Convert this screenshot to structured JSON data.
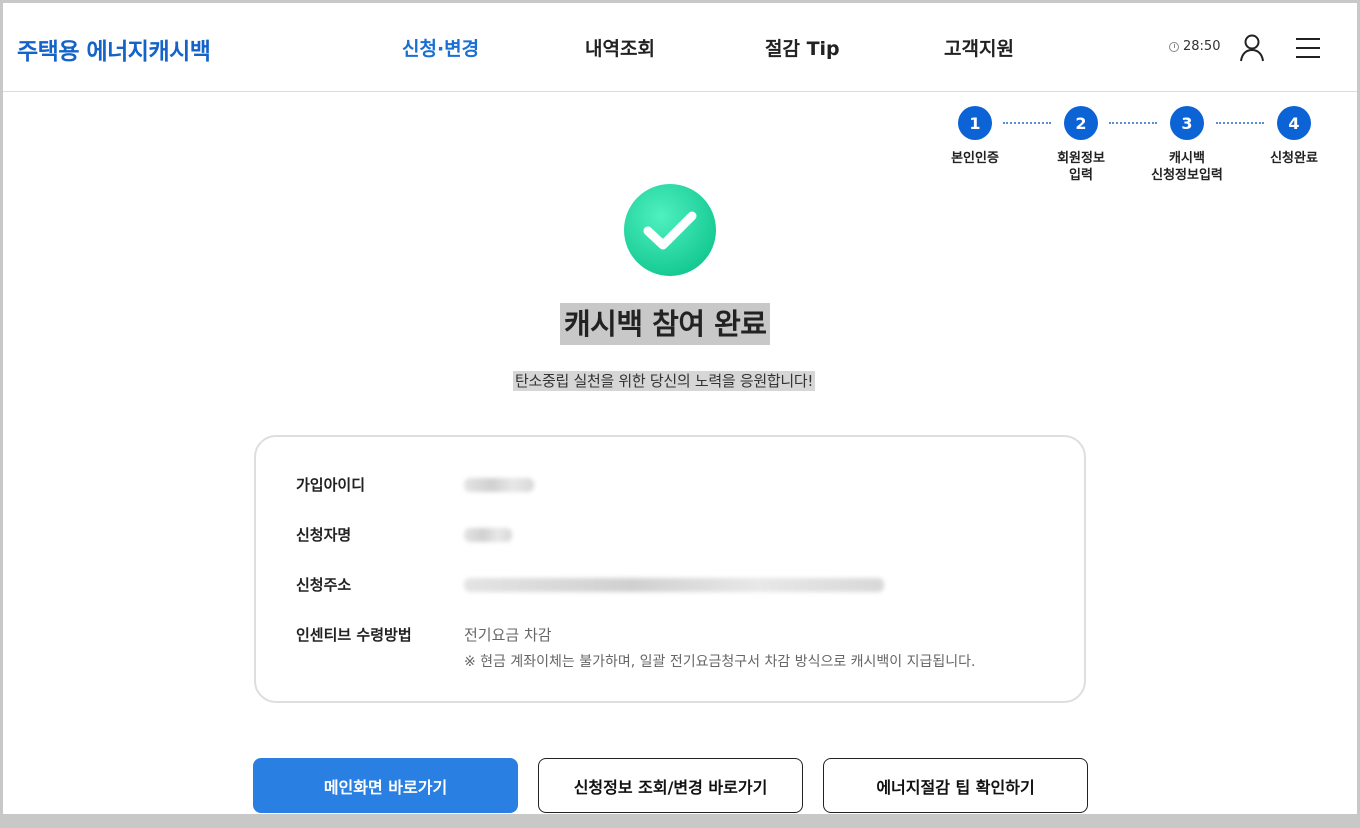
{
  "header": {
    "logo": "주택용 에너지캐시백",
    "nav": [
      "신청·변경",
      "내역조회",
      "절감 Tip",
      "고객지원"
    ],
    "active_nav_index": 0,
    "timer": "28:50",
    "user_icon": "user-icon",
    "menu_icon": "hamburger-menu-icon"
  },
  "stepper": {
    "steps": [
      {
        "number": "1",
        "label_line1": "본인인증",
        "label_line2": ""
      },
      {
        "number": "2",
        "label_line1": "회원정보",
        "label_line2": "입력"
      },
      {
        "number": "3",
        "label_line1": "캐시백",
        "label_line2": "신청정보입력"
      },
      {
        "number": "4",
        "label_line1": "신청완료",
        "label_line2": ""
      }
    ],
    "current_step": 4
  },
  "result": {
    "icon": "check-circle-icon",
    "title": "캐시백 참여 완료",
    "subtitle": "탄소중립 실천을 위한 당신의 노력을 응원합니다!"
  },
  "info": {
    "id_label": "가입아이디",
    "name_label": "신청자명",
    "address_label": "신청주소",
    "incentive_label": "인센티브 수령방법",
    "incentive_value": "전기요금 차감",
    "incentive_note": "※ 현금 계좌이체는 불가하며, 일괄 전기요금청구서 차감 방식으로 캐시백이 지급됩니다."
  },
  "buttons": {
    "main": "메인화면 바로가기",
    "lookup": "신청정보 조회/변경 바로가기",
    "tips": "에너지절감 팁 확인하기"
  },
  "colors": {
    "brand": "#1463c8",
    "primary_button": "#2a7fe2",
    "step": "#0b63d6",
    "check": "#1ed6a0"
  }
}
